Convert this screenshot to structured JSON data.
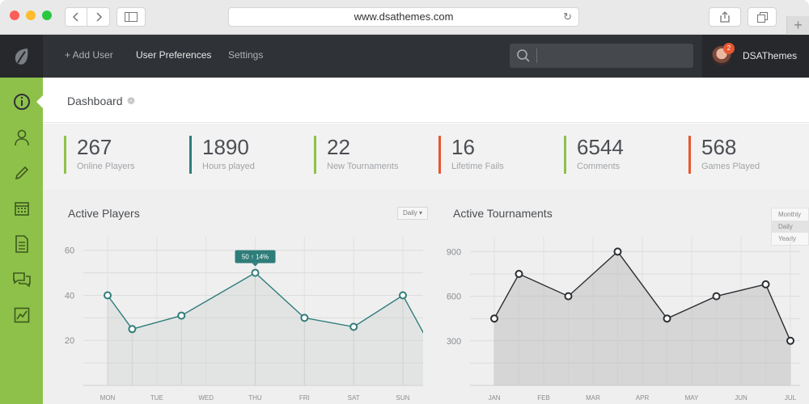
{
  "browser": {
    "url": "www.dsathemes.com",
    "back_icon": "chevron-left-icon",
    "forward_icon": "chevron-right-icon",
    "new_tab": "+"
  },
  "topnav": {
    "add_user": "+ Add User",
    "preferences": "User Preferences",
    "settings": "Settings",
    "search_placeholder": "",
    "user": {
      "name": "DSAThemes",
      "notifications": "2"
    }
  },
  "sidebar": {
    "items": [
      {
        "icon": "info-icon",
        "active": true
      },
      {
        "icon": "user-icon"
      },
      {
        "icon": "pencil-icon"
      },
      {
        "icon": "calendar-icon"
      },
      {
        "icon": "document-icon"
      },
      {
        "icon": "chat-icon"
      },
      {
        "icon": "line-chart-icon"
      }
    ]
  },
  "page": {
    "title": "Dashboard"
  },
  "stats": [
    {
      "value": "267",
      "label": "Online Players",
      "color": "#8ec14a"
    },
    {
      "value": "1890",
      "label": "Hours played",
      "color": "#2f7d7a"
    },
    {
      "value": "22",
      "label": "New Tournaments",
      "color": "#8ec14a"
    },
    {
      "value": "16",
      "label": "Lifetime Fails",
      "color": "#e8572f"
    },
    {
      "value": "6544",
      "label": "Comments",
      "color": "#8ec14a"
    },
    {
      "value": "568",
      "label": "Games Played",
      "color": "#e8572f"
    }
  ],
  "colors": {
    "accent_green": "#8ec14a",
    "teal": "#2f7d7a",
    "orange": "#e8572f",
    "dark_nav": "#2f3237"
  },
  "chart_data": [
    {
      "type": "line",
      "title": "Active Players",
      "filter": "Daily",
      "categories": [
        "MON",
        "TUE",
        "WED",
        "THU",
        "FRI",
        "SAT",
        "SUN"
      ],
      "values": [
        40,
        25,
        31,
        50,
        30,
        26,
        40,
        20
      ],
      "x_points": [
        0,
        0.5,
        1.5,
        3,
        4,
        5,
        6,
        6.5
      ],
      "yticks": [
        20,
        40,
        60
      ],
      "ylim": [
        0,
        66
      ],
      "tooltip": {
        "value": "50",
        "change": "14%"
      },
      "color": "#2f7d7a"
    },
    {
      "type": "area",
      "title": "Active Tournaments",
      "range_options": [
        "Monthly",
        "Daily",
        "Yearly"
      ],
      "range_selected": "Daily",
      "categories": [
        "JAN",
        "FEB",
        "MAR",
        "APR",
        "MAY",
        "JUN",
        "JUL"
      ],
      "values": [
        450,
        750,
        600,
        900,
        450,
        600,
        680,
        300
      ],
      "x_points": [
        0,
        0.5,
        1.5,
        2.5,
        3.5,
        4.5,
        5.5,
        6.0
      ],
      "yticks": [
        300,
        600,
        900
      ],
      "ylim": [
        0,
        1000
      ],
      "color": "#2b2e33"
    }
  ]
}
